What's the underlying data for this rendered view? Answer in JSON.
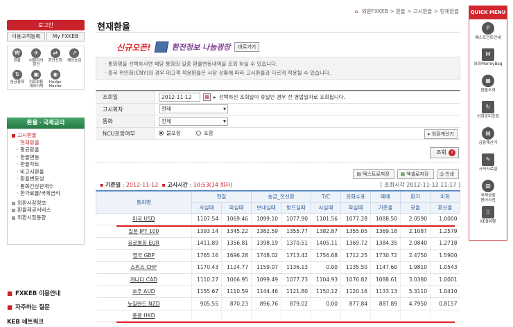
{
  "left": {
    "login": "로그인",
    "register": "이용고객등록",
    "my": "My FXKEB",
    "tools": [
      {
        "icon": "currency-icon",
        "glyph": "₩",
        "label": "환율"
      },
      {
        "icon": "airplane-icon",
        "glyph": "✈",
        "label": "여행자외\n환전"
      },
      {
        "icon": "exchange-icon",
        "glyph": "⇄",
        "label": "환전신청"
      },
      {
        "icon": "wire-icon",
        "glyph": "↗",
        "label": "해외송금"
      },
      {
        "icon": "remit-icon",
        "glyph": "⇅",
        "label": "송금결제"
      },
      {
        "icon": "account-icon",
        "glyph": "▣",
        "label": "외화보통\n계좌이체"
      },
      {
        "icon": "hedge-icon",
        "glyph": "◉",
        "label": "Hedge\nMaster"
      }
    ],
    "section_title": "환율ㆍ국제금리",
    "menu": [
      {
        "label": "고시환율",
        "type": "main",
        "on": true
      },
      {
        "label": "현재환율",
        "type": "sub",
        "on": true
      },
      {
        "label": "평균환율",
        "type": "sub"
      },
      {
        "label": "환율변동",
        "type": "sub"
      },
      {
        "label": "환율차트",
        "type": "sub"
      },
      {
        "label": "비고시환율",
        "type": "sub"
      },
      {
        "label": "환율변동성",
        "type": "sub"
      },
      {
        "label": "통화간상관계수",
        "type": "sub"
      },
      {
        "label": "환가료율/국제금리",
        "type": "sub"
      },
      {
        "label": "외환시장정보",
        "type": "main"
      },
      {
        "label": "환율제공서비스",
        "type": "main"
      },
      {
        "label": "외환시장동향",
        "type": "main"
      }
    ],
    "bottom_links": [
      "FXKEB 이용안내",
      "자주하는 질문",
      "KEB 네트워크"
    ]
  },
  "breadcrumb": [
    "외환FXKEB",
    "환율",
    "고시환율",
    "현재환율"
  ],
  "page_title": "현재환율",
  "banner": {
    "new": "신규오픈!",
    "name": "환전정보 나눔광장",
    "go": "바로가기"
  },
  "notices": [
    "통화명을 선택하시면 해당 통화의 일중 환율변동내역을 조회 하실 수 있습니다.",
    "중국 위안화(CNY)의 경우 대고객 적용환율은 시장 상황에 따라 고시환율과 다르게 적용될 수 있습니다."
  ],
  "form": {
    "date_label": "조회일",
    "date_value": "2012-11-12",
    "date_note": "선택하신 조회일이 휴일인 경우 전 영업일자로 조회됩니다.",
    "round_label": "고시회차",
    "round_value": "현재",
    "currency_label": "통화",
    "currency_value": "전체",
    "ncu_label": "NCU포함여부",
    "ncu_opt1": "불포함",
    "ncu_opt2": "포함",
    "calc": "외환계산기",
    "search": "조회"
  },
  "export": {
    "text": "텍스트로저장",
    "excel": "엑셀로저장",
    "print": "인쇄"
  },
  "info": {
    "base_label": "기준일",
    "base_value": "2012-11-12",
    "time_label": "고시시간",
    "time_value": "10:53(14 회차)",
    "query_time": "[ 조회시각 2012-11-12 11:17 ]"
  },
  "table": {
    "group_headers": [
      "통화명",
      "현찰",
      "송금_전신환",
      "T/C",
      "외화수표",
      "매매",
      "환가",
      "미화"
    ],
    "sub_headers": [
      "사실때",
      "파실때",
      "보내실때",
      "받으실때",
      "사실때",
      "파실때",
      "기준율",
      "료율",
      "환산율"
    ],
    "rows": [
      [
        "미국 USD",
        "1107.54",
        "1069.46",
        "1099.10",
        "1077.90",
        "1101.56",
        "1077.28",
        "1088.50",
        "2.0590",
        "1.0000"
      ],
      [
        "일본 JPY 100",
        "1393.14",
        "1345.22",
        "1382.59",
        "1355.77",
        "1382.87",
        "1355.05",
        "1369.18",
        "2.1087",
        "1.2579"
      ],
      [
        "유로통화 EUR",
        "1411.89",
        "1356.81",
        "1398.19",
        "1370.51",
        "1405.11",
        "1369.72",
        "1384.35",
        "2.0840",
        "1.2718"
      ],
      [
        "영국 GBP",
        "1765.16",
        "1696.28",
        "1748.02",
        "1713.42",
        "1756.68",
        "1712.25",
        "1730.72",
        "2.4750",
        "1.5900"
      ],
      [
        "스위스 CHF",
        "1170.43",
        "1124.77",
        "1159.07",
        "1136.13",
        "0.00",
        "1135.50",
        "1147.60",
        "1.9810",
        "1.0543"
      ],
      [
        "캐나다 CAD",
        "1110.27",
        "1066.95",
        "1099.49",
        "1077.73",
        "1104.93",
        "1076.82",
        "1088.61",
        "3.0380",
        "1.0001"
      ],
      [
        "호주 AUD",
        "1155.67",
        "1110.59",
        "1144.46",
        "1121.80",
        "1150.12",
        "1120.16",
        "1133.13",
        "5.3110",
        "1.0410"
      ],
      [
        "뉴질랜드 NZD",
        "905.55",
        "870.23",
        "896.76",
        "879.02",
        "0.00",
        "877.84",
        "887.89",
        "4.7950",
        "0.8157"
      ],
      [
        "홍콩 HKD",
        "",
        "",
        "",
        "",
        "",
        "",
        "",
        "",
        ""
      ]
    ]
  },
  "quick_menu": {
    "title": "QUICK MENU",
    "items": [
      {
        "icon": "point-icon",
        "glyph": "P",
        "label": "예스포인트안내"
      },
      {
        "icon": "money-bag-icon",
        "glyph": "M",
        "label": "외화MoneyBag"
      },
      {
        "icon": "rate-query-icon",
        "glyph": "▦",
        "label": "환율조회"
      },
      {
        "icon": "interest-icon",
        "glyph": "↻",
        "label": "외화금리조회"
      },
      {
        "icon": "calculator-icon",
        "glyph": "▤",
        "label": "금융계산기"
      },
      {
        "icon": "book-icon",
        "glyph": "✎",
        "label": "서식자료실"
      },
      {
        "icon": "finance-icon",
        "glyph": "▥",
        "label": "국제금융\n용어사전"
      },
      {
        "icon": "keb-mobile-icon",
        "glyph": "▯",
        "label": "KEB여행"
      }
    ]
  }
}
